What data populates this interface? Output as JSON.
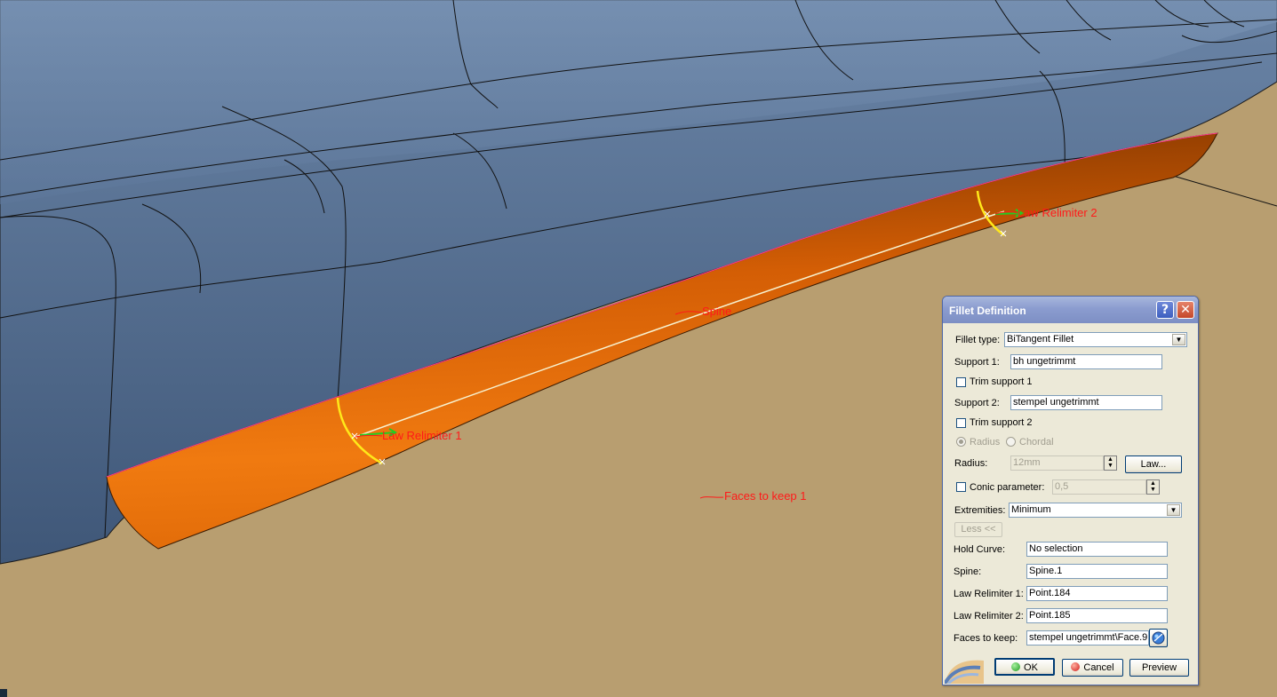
{
  "annotations": {
    "law_relimiter_2": "Law Relimiter 2",
    "spine": "Spine",
    "law_relimiter_1": "Law Relimiter 1",
    "faces_to_keep": "Faces to keep 1"
  },
  "dialog": {
    "title": "Fillet Definition",
    "help_glyph": "?",
    "close_glyph": "✕",
    "fillet_type_label": "Fillet type:",
    "fillet_type_value": "BiTangent Fillet",
    "support1_label": "Support 1:",
    "support1_value": "bh ungetrimmt",
    "trim_support1_label": "Trim support 1",
    "support2_label": "Support 2:",
    "support2_value": "stempel ungetrimmt",
    "trim_support2_label": "Trim support 2",
    "radius_option_label": "Radius",
    "chordal_option_label": "Chordal",
    "radius_label": "Radius:",
    "radius_value": "12mm",
    "law_button": "Law...",
    "conic_label": "Conic parameter:",
    "conic_value": "0,5",
    "extremities_label": "Extremities:",
    "extremities_value": "Minimum",
    "less_button": "Less <<",
    "hold_curve_label": "Hold Curve:",
    "hold_curve_value": "No selection",
    "spine_label": "Spine:",
    "spine_value": "Spine.1",
    "law_relimiter1_label": "Law Relimiter 1:",
    "law_relimiter1_value": "Point.184",
    "law_relimiter2_label": "Law Relimiter 2:",
    "law_relimiter2_value": "Point.185",
    "faces_to_keep_label": "Faces to keep:",
    "faces_to_keep_value": "stempel ungetrimmt\\Face.9",
    "ok_button": "OK",
    "cancel_button": "Cancel",
    "preview_button": "Preview"
  },
  "colors": {
    "surface_blue": "#4f6a8c",
    "ground_tan": "#b89e70",
    "fillet_orange": "#e86b06",
    "annotation_red": "#ff1a1a"
  }
}
